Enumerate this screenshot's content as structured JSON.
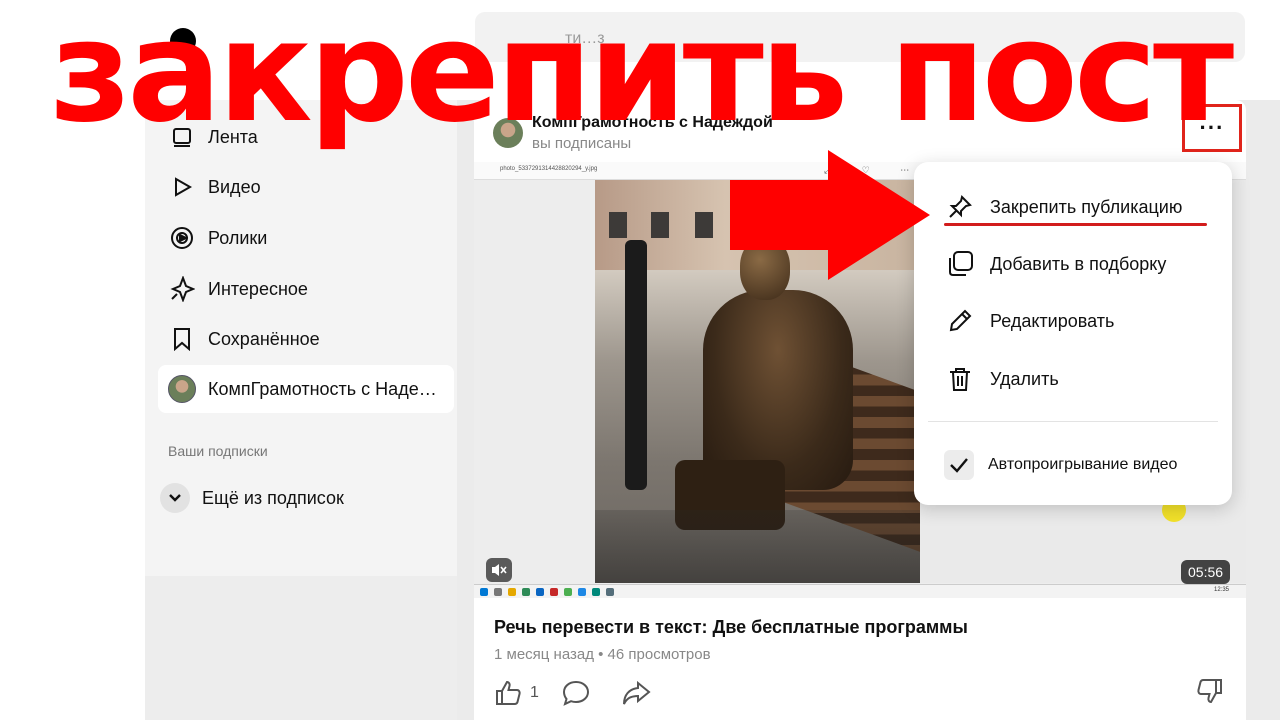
{
  "overlay": {
    "headline": "закрепить пост"
  },
  "topbar": {
    "search_placeholder": "ти…з"
  },
  "sidebar": {
    "items": [
      {
        "label": "Лента",
        "icon": "feed-icon"
      },
      {
        "label": "Видео",
        "icon": "play-icon"
      },
      {
        "label": "Ролики",
        "icon": "shorts-icon"
      },
      {
        "label": "Интересное",
        "icon": "sparkle-icon"
      },
      {
        "label": "Сохранённое",
        "icon": "bookmark-icon"
      },
      {
        "label": "КомпГрамотность с Наде…",
        "icon": "channel-avatar",
        "active": true
      }
    ],
    "subscriptions_caption": "Ваши подписки",
    "more_subscriptions": "Ещё из подписок"
  },
  "post": {
    "channel_name": "КомпГрамотность с Надеждой",
    "channel_status": "вы подписаны",
    "more_button": "···",
    "video": {
      "file_name": "photo_5337291314428820294_y.jpg",
      "duration": "05:56",
      "mute_icon": "mute-icon",
      "taskbar_time": "12:35",
      "taskbar_lang": "РУС"
    },
    "title": "Речь перевести в текст: Две бесплатные программы",
    "meta": "1 месяц назад • 46 просмотров",
    "likes": "1"
  },
  "menu": {
    "items": [
      {
        "label": "Закрепить публикацию",
        "icon": "pin-icon"
      },
      {
        "label": "Добавить в подборку",
        "icon": "copy-icon"
      },
      {
        "label": "Редактировать",
        "icon": "pencil-icon"
      },
      {
        "label": "Удалить",
        "icon": "trash-icon"
      }
    ],
    "autoplay_label": "Автопроигрывание видео",
    "autoplay_checked": true
  },
  "colors": {
    "headline_red": "#ff0000",
    "highlight_red": "#e0241b",
    "underline_red": "#d21c1c"
  }
}
